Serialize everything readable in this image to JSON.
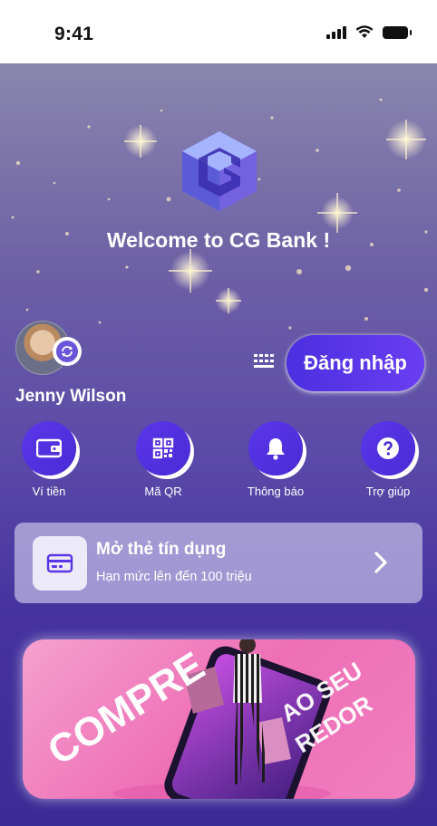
{
  "status_bar": {
    "time": "9:41"
  },
  "header": {
    "welcome": "Welcome to CG Bank !"
  },
  "user": {
    "name": "Jenny Wilson"
  },
  "login": {
    "label": "Đăng nhập"
  },
  "quick_actions": [
    {
      "label": "Ví tiền",
      "icon": "wallet-icon"
    },
    {
      "label": "Mã QR",
      "icon": "qr-code-icon"
    },
    {
      "label": "Thông báo",
      "icon": "bell-icon"
    },
    {
      "label": "Trợ giúp",
      "icon": "help-icon"
    }
  ],
  "credit_card_promo": {
    "title": "Mở thẻ tín dụng",
    "subtitle": "Hạn mức lên đến 100 triệu",
    "icon": "credit-card-icon"
  },
  "banner": {
    "text_left": "COMPRE",
    "text_right_1": "AO SEU",
    "text_right_2": "REDOR"
  },
  "colors": {
    "accent": "#5a36e8",
    "background_top": "#8a86ad",
    "background_bottom": "#3c2a95",
    "banner_pink": "#ee6fb6"
  }
}
